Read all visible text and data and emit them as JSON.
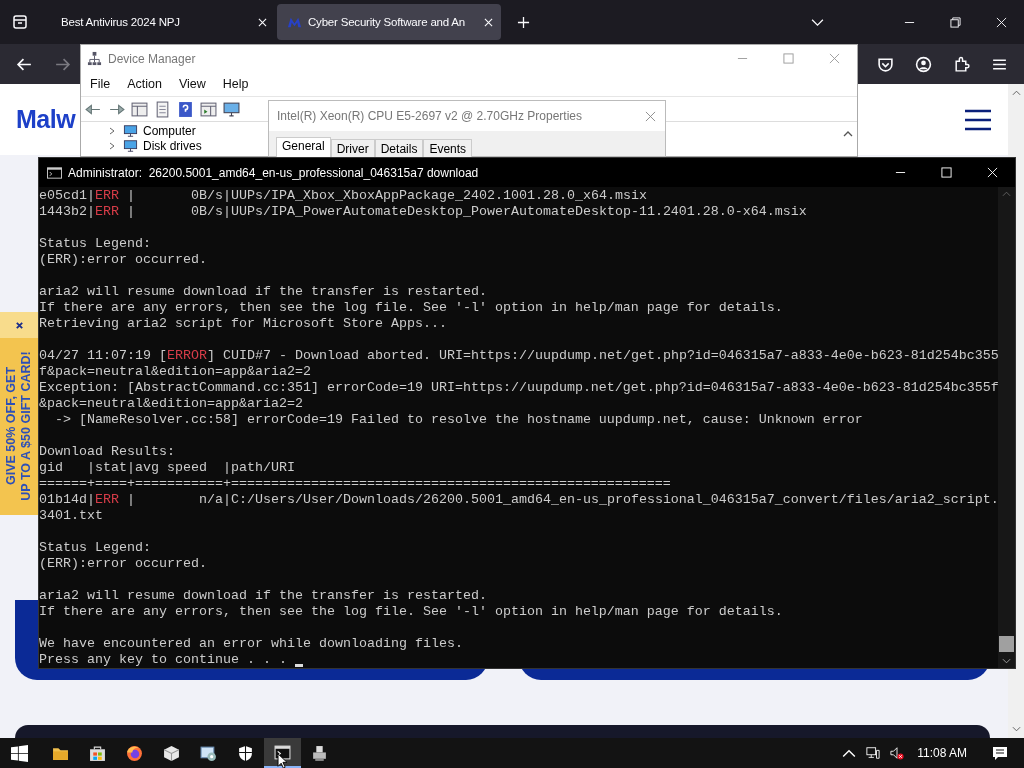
{
  "browser": {
    "tabs": [
      {
        "label": "Best Antivirus 2024 NPJ",
        "selected": false,
        "has_icon": false
      },
      {
        "label": "Cyber Security Software and An",
        "selected": true,
        "has_icon": true
      }
    ],
    "logo_text": "Malw",
    "promo": {
      "lines": [
        "GIVE 50% OFF, GET",
        "UP TO A $50 GIFT CARD!"
      ]
    }
  },
  "device_manager": {
    "title": "Device Manager",
    "menu": [
      "File",
      "Action",
      "View",
      "Help"
    ],
    "tree": [
      {
        "label": "Computer",
        "expanded": false
      },
      {
        "label": "Disk drives",
        "expanded": false
      }
    ]
  },
  "properties": {
    "title": "Intel(R) Xeon(R) CPU E5-2697 v2 @ 2.70GHz Properties",
    "tabs": [
      {
        "label": "General",
        "selected": true
      },
      {
        "label": "Driver",
        "selected": false
      },
      {
        "label": "Details",
        "selected": false
      },
      {
        "label": "Events",
        "selected": false
      }
    ]
  },
  "console": {
    "title": "Administrator:  26200.5001_amd64_en-us_professional_046315a7 download",
    "cursor_visible": true,
    "lines": [
      {
        "kind": "text",
        "parts": [
          {
            "text": "e05cd1|",
            "kind": "plain"
          },
          {
            "text": "ERR",
            "kind": "error"
          },
          {
            "text": " |       0B/s|UUPs/IPA_Xbox_XboxAppPackage_2402.1001.28.0_x64.msix",
            "kind": "plain"
          }
        ]
      },
      {
        "kind": "text",
        "parts": [
          {
            "text": "1443b2|",
            "kind": "plain"
          },
          {
            "text": "ERR",
            "kind": "error"
          },
          {
            "text": " |       0B/s|UUPs/IPA_PowerAutomateDesktop_PowerAutomateDesktop-11.2401.28.0-x64.msix",
            "kind": "plain"
          }
        ]
      },
      {
        "kind": "blank"
      },
      {
        "kind": "text",
        "parts": [
          {
            "text": "Status Legend:",
            "kind": "plain"
          }
        ]
      },
      {
        "kind": "text",
        "parts": [
          {
            "text": "(ERR):error occurred.",
            "kind": "plain"
          }
        ]
      },
      {
        "kind": "blank"
      },
      {
        "kind": "text",
        "parts": [
          {
            "text": "aria2 will resume download if the transfer is restarted.",
            "kind": "plain"
          }
        ]
      },
      {
        "kind": "text",
        "parts": [
          {
            "text": "If there are any errors, then see the log file. See '-l' option in help/man page for details.",
            "kind": "plain"
          }
        ]
      },
      {
        "kind": "text",
        "parts": [
          {
            "text": "Retrieving aria2 script for Microsoft Store Apps...",
            "kind": "plain"
          }
        ]
      },
      {
        "kind": "blank"
      },
      {
        "kind": "text",
        "parts": [
          {
            "text": "04/27 11:07:19 [",
            "kind": "plain"
          },
          {
            "text": "ERROR",
            "kind": "error"
          },
          {
            "text": "] CUID#7 - Download aborted. URI=https://uupdump.net/get.php?id=046315a7-a833-4e0e-b623-81d254bc355",
            "kind": "plain"
          }
        ]
      },
      {
        "kind": "text",
        "parts": [
          {
            "text": "f&pack=neutral&edition=app&aria2=2",
            "kind": "plain"
          }
        ]
      },
      {
        "kind": "text",
        "parts": [
          {
            "text": "Exception: [AbstractCommand.cc:351] errorCode=19 URI=https://uupdump.net/get.php?id=046315a7-a833-4e0e-b623-81d254bc355f",
            "kind": "plain"
          }
        ]
      },
      {
        "kind": "text",
        "parts": [
          {
            "text": "&pack=neutral&edition=app&aria2=2",
            "kind": "plain"
          }
        ]
      },
      {
        "kind": "text",
        "parts": [
          {
            "text": "  -> [NameResolver.cc:58] errorCode=19 Failed to resolve the hostname uupdump.net, cause: Unknown error",
            "kind": "plain"
          }
        ]
      },
      {
        "kind": "blank"
      },
      {
        "kind": "text",
        "parts": [
          {
            "text": "Download Results:",
            "kind": "plain"
          }
        ]
      },
      {
        "kind": "text",
        "parts": [
          {
            "text": "gid   |stat|avg speed  |path/URI",
            "kind": "plain"
          }
        ]
      },
      {
        "kind": "text",
        "parts": [
          {
            "text": "======+====+===========+=======================================================",
            "kind": "plain"
          }
        ]
      },
      {
        "kind": "text",
        "parts": [
          {
            "text": "01b14d|",
            "kind": "plain"
          },
          {
            "text": "ERR",
            "kind": "error"
          },
          {
            "text": " |        n/a|C:/Users/User/Downloads/26200.5001_amd64_en-us_professional_046315a7_convert/files/aria2_script.",
            "kind": "plain"
          }
        ]
      },
      {
        "kind": "text",
        "parts": [
          {
            "text": "3401.txt",
            "kind": "plain"
          }
        ]
      },
      {
        "kind": "blank"
      },
      {
        "kind": "text",
        "parts": [
          {
            "text": "Status Legend:",
            "kind": "plain"
          }
        ]
      },
      {
        "kind": "text",
        "parts": [
          {
            "text": "(ERR):error occurred.",
            "kind": "plain"
          }
        ]
      },
      {
        "kind": "blank"
      },
      {
        "kind": "text",
        "parts": [
          {
            "text": "aria2 will resume download if the transfer is restarted.",
            "kind": "plain"
          }
        ]
      },
      {
        "kind": "text",
        "parts": [
          {
            "text": "If there are any errors, then see the log file. See '-l' option in help/man page for details.",
            "kind": "plain"
          }
        ]
      },
      {
        "kind": "blank"
      },
      {
        "kind": "text",
        "parts": [
          {
            "text": "We have encountered an error while downloading files.",
            "kind": "plain"
          }
        ]
      },
      {
        "kind": "text",
        "parts": [
          {
            "text": "Press any key to continue . . . ",
            "kind": "plain"
          }
        ]
      }
    ]
  },
  "taskbar": {
    "apps": [
      {
        "kind": "folder",
        "selected": false
      },
      {
        "kind": "bag",
        "selected": false
      },
      {
        "kind": "browser",
        "selected": false
      },
      {
        "kind": "cube",
        "selected": false
      },
      {
        "kind": "app",
        "selected": false
      },
      {
        "kind": "shield",
        "selected": false
      },
      {
        "kind": "terminal",
        "selected": true
      },
      {
        "kind": "printer",
        "selected": false
      }
    ],
    "volume_muted": true,
    "time": "11:08 AM"
  }
}
